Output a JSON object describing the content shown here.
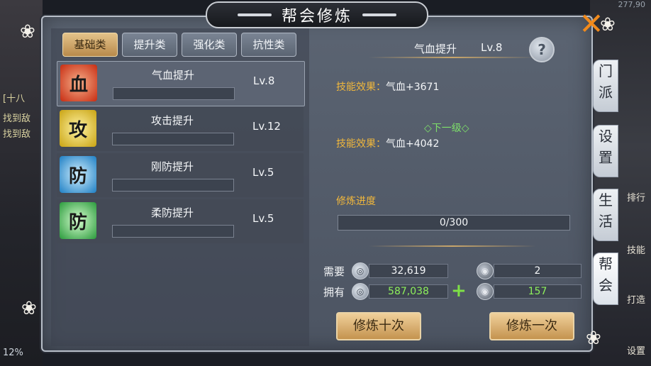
{
  "background": {
    "left_lines": [
      "[十八",
      "找到敌",
      "找到敌"
    ],
    "left_percent": "12%",
    "right_labels": [
      "排行",
      "技能",
      "打造",
      "设置"
    ],
    "top_right_coords": "277,90"
  },
  "window": {
    "title": "帮会修炼"
  },
  "tabs": [
    {
      "label": "基础类",
      "active": true
    },
    {
      "label": "提升类",
      "active": false
    },
    {
      "label": "强化类",
      "active": false
    },
    {
      "label": "抗性类",
      "active": false
    }
  ],
  "skills": [
    {
      "name": "气血提升",
      "level": "Lv.8",
      "icon_char": "血",
      "icon": "blood-icon",
      "color": "#d23a1e",
      "selected": true
    },
    {
      "name": "攻击提升",
      "level": "Lv.12",
      "icon_char": "攻",
      "icon": "attack-icon",
      "color": "#e0c21e",
      "selected": false
    },
    {
      "name": "刚防提升",
      "level": "Lv.5",
      "icon_char": "防",
      "icon": "defense-icon",
      "color": "#2a8fd6",
      "selected": false
    },
    {
      "name": "柔防提升",
      "level": "Lv.5",
      "icon_char": "防",
      "icon": "soft-defense-icon",
      "color": "#32b34a",
      "selected": false
    }
  ],
  "detail": {
    "name": "气血提升",
    "level": "Lv.8",
    "help": "?",
    "current_effect_key": "技能效果：",
    "current_effect_val": "气血+3671",
    "next_level_label": "◇下一级◇",
    "next_effect_key": "技能效果：",
    "next_effect_val": "气血+4042",
    "progress_label": "修炼进度",
    "progress_text": "0/300",
    "progress_fraction": 0
  },
  "resources": {
    "need_label": "需要",
    "have_label": "拥有",
    "need_silver": "32,619",
    "have_silver": "587,038",
    "need_coin": "2",
    "have_coin": "157",
    "plus": "+"
  },
  "actions": {
    "train_ten": "修炼十次",
    "train_one": "修炼一次"
  },
  "side_tabs": [
    {
      "chars": [
        "门",
        "派"
      ],
      "active": false
    },
    {
      "chars": [
        "设",
        "置"
      ],
      "active": false
    },
    {
      "chars": [
        "生",
        "活"
      ],
      "active": false
    },
    {
      "chars": [
        "帮",
        "会"
      ],
      "active": true
    }
  ],
  "close": "✕",
  "colors": {
    "accent": "#f0b73c",
    "green": "#8ef05c",
    "close": "#f18a1c"
  }
}
